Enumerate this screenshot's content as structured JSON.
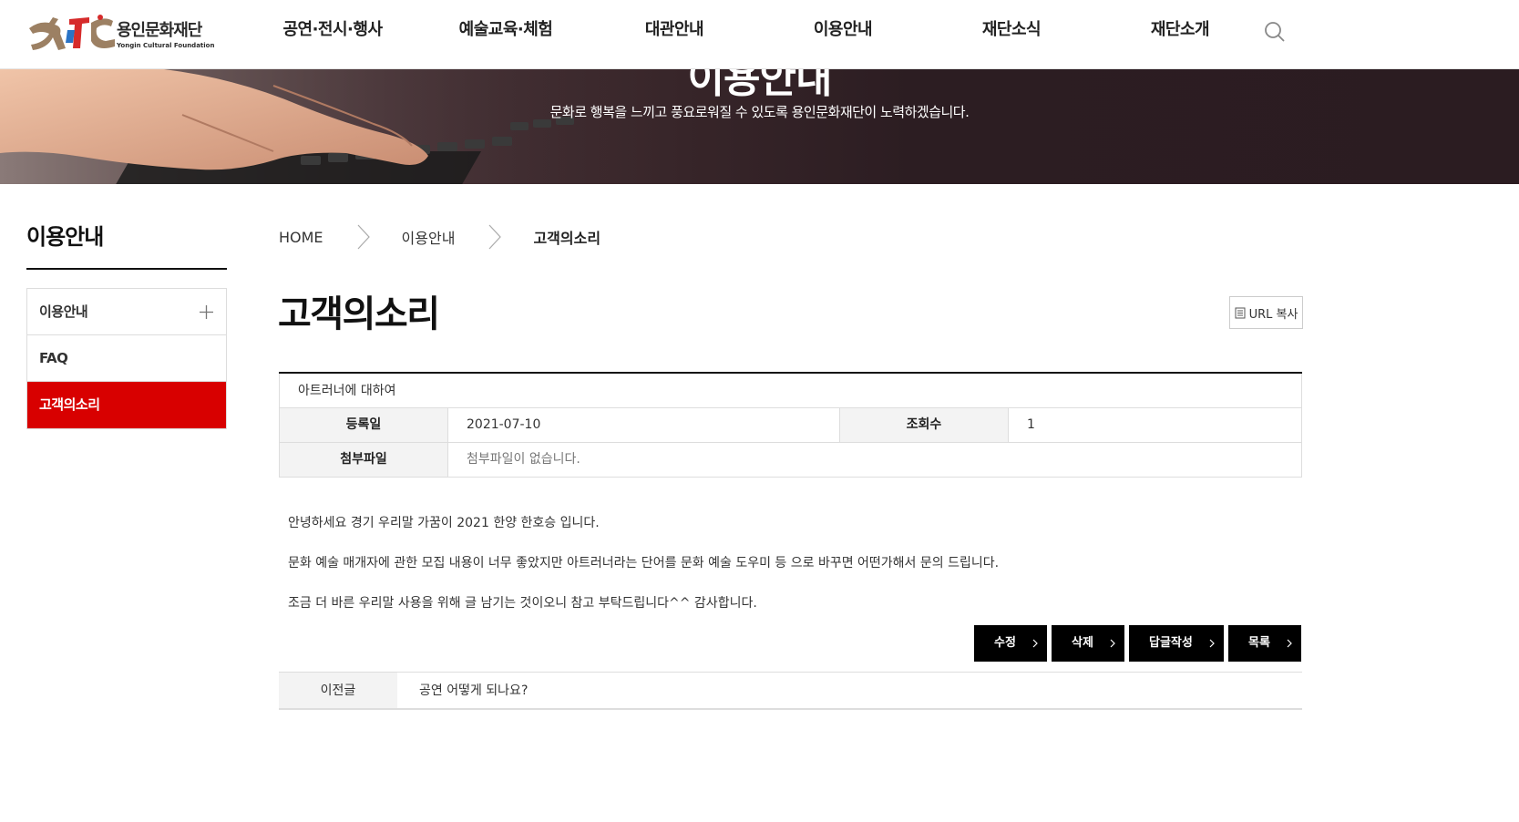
{
  "header": {
    "logo_kr": "용인문화재단",
    "logo_en": "Yongin Cultural Foundation",
    "nav": [
      "공연·전시·행사",
      "예술교육·체험",
      "대관안내",
      "이용안내",
      "재단소식",
      "재단소개"
    ]
  },
  "banner": {
    "title": "이용안내",
    "subtitle": "문화로 행복을 느끼고 풍요로워질 수 있도록 용인문화재단이 노력하겠습니다."
  },
  "sidebar": {
    "title": "이용안내",
    "items": [
      {
        "label": "이용안내",
        "expandable": true,
        "active": false
      },
      {
        "label": "FAQ",
        "expandable": false,
        "active": false
      },
      {
        "label": "고객의소리",
        "expandable": false,
        "active": true
      }
    ]
  },
  "breadcrumb": [
    "HOME",
    "이용안내",
    "고객의소리"
  ],
  "page": {
    "title": "고객의소리",
    "url_copy_label": "URL 복사"
  },
  "post": {
    "subject": "아트러너에 대하여",
    "date_label": "등록일",
    "date": "2021-07-10",
    "views_label": "조회수",
    "views": "1",
    "files_label": "첨부파일",
    "files": "첨부파일이 없습니다.",
    "body": [
      "안녕하세요 경기 우리말 가꿈이 2021 한양 한호승 입니다.",
      "문화 예술 매개자에 관한 모집 내용이 너무 좋았지만 아트러너라는 단어를 문화 예술 도우미 등 으로 바꾸면  어떤가해서 문의 드립니다.",
      "조금 더 바른 우리말 사용을 위해 글 남기는 것이오니 참고 부탁드립니다^^ 감사합니다."
    ]
  },
  "actions": {
    "edit": "수정",
    "delete": "삭제",
    "reply": "답글작성",
    "list": "목록"
  },
  "prev_post": {
    "label": "이전글",
    "title": "공연 어떻게 되나요?"
  },
  "colors": {
    "accent_red": "#d80000",
    "dark": "#000000",
    "banner": "#2b1c21"
  }
}
